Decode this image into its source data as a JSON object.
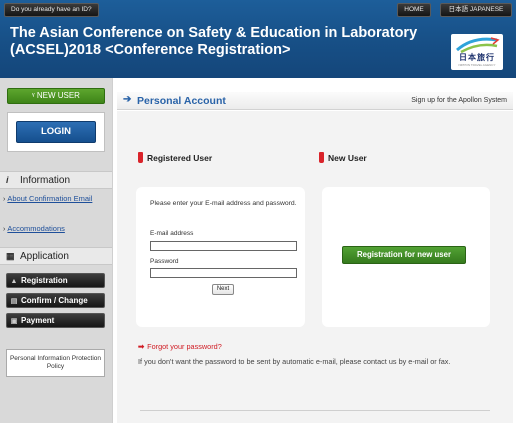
{
  "header": {
    "already_label": "Do you already have an ID?",
    "home_label": "HOME",
    "lang_label": "日本語 JAPANESE",
    "title_line1": "The Asian Conference on Safety & Education in Laboratory",
    "title_line2": "(ACSEL)2018 <Conference Registration>",
    "logo_text": "日本旅行",
    "logo_sub": "NIPPON TRAVEL AGENCY"
  },
  "sidebar": {
    "new_user_label": "NEW USER",
    "login_label": "LOGIN",
    "information": {
      "heading": "Information",
      "links": [
        "About Confirmation Email",
        "Accommodations"
      ]
    },
    "application": {
      "heading": "Application",
      "buttons": [
        "Registration",
        "Confirm / Change",
        "Payment"
      ]
    },
    "policy_label": "Personal Information Protection Policy"
  },
  "main": {
    "section_title": "Personal Account",
    "signup_text": "Sign up for the Apollon System",
    "registered": {
      "label": "Registered User",
      "instruction": "Please enter your E-mail address and password.",
      "email_label": "E-mail address",
      "password_label": "Password",
      "next_label": "Next"
    },
    "new_user": {
      "label": "New User",
      "button_label": "Registration for new user"
    },
    "forgot_label": "Forgot your password?",
    "note": "If you don't want the password to be sent by automatic e-mail, please contact us by e-mail or fax."
  },
  "colors": {
    "header_blue": "#174f86",
    "accent_blue": "#2a63a8",
    "green": "#3e8418",
    "red": "#d9232a"
  }
}
